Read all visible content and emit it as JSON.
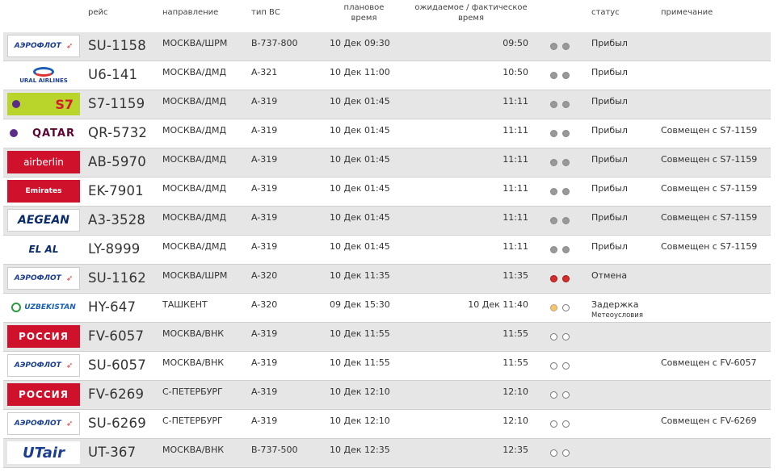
{
  "headers": {
    "flight": "рейс",
    "destination": "направление",
    "aircraft": "тип ВС",
    "scheduled": "плановое время",
    "actual": "ожидаемое / фактическое время",
    "status": "статус",
    "remark": "примечание"
  },
  "rows": [
    {
      "airline": "aeroflot",
      "logo_text": "АЭРОФЛОТ",
      "flight": "SU-1158",
      "dest": "МОСКВА/ШРМ",
      "aircraft": "B-737-800",
      "scheduled": "10 Дек 09:30",
      "actual": "09:50",
      "dots": [
        "grey",
        "grey"
      ],
      "status": "Прибыл",
      "note": "",
      "remark": ""
    },
    {
      "airline": "ural",
      "logo_text": "URAL AIRLINES",
      "flight": "U6-141",
      "dest": "МОСКВА/ДМД",
      "aircraft": "A-321",
      "scheduled": "10 Дек 11:00",
      "actual": "10:50",
      "dots": [
        "grey",
        "grey"
      ],
      "status": "Прибыл",
      "note": "",
      "remark": ""
    },
    {
      "airline": "s7",
      "logo_text": "S7",
      "flight": "S7-1159",
      "dest": "МОСКВА/ДМД",
      "aircraft": "A-319",
      "scheduled": "10 Дек 01:45",
      "actual": "11:11",
      "dots": [
        "grey",
        "grey"
      ],
      "status": "Прибыл",
      "note": "",
      "remark": ""
    },
    {
      "airline": "qatar",
      "logo_text": "QATAR",
      "flight": "QR-5732",
      "dest": "МОСКВА/ДМД",
      "aircraft": "A-319",
      "scheduled": "10 Дек 01:45",
      "actual": "11:11",
      "dots": [
        "grey",
        "grey"
      ],
      "status": "Прибыл",
      "note": "",
      "remark": "Совмещен с S7-1159"
    },
    {
      "airline": "airberlin",
      "logo_text": "airberlin",
      "flight": "AB-5970",
      "dest": "МОСКВА/ДМД",
      "aircraft": "A-319",
      "scheduled": "10 Дек 01:45",
      "actual": "11:11",
      "dots": [
        "grey",
        "grey"
      ],
      "status": "Прибыл",
      "note": "",
      "remark": "Совмещен с S7-1159"
    },
    {
      "airline": "emirates",
      "logo_text": "Emirates",
      "flight": "EK-7901",
      "dest": "МОСКВА/ДМД",
      "aircraft": "A-319",
      "scheduled": "10 Дек 01:45",
      "actual": "11:11",
      "dots": [
        "grey",
        "grey"
      ],
      "status": "Прибыл",
      "note": "",
      "remark": "Совмещен с S7-1159"
    },
    {
      "airline": "aegean",
      "logo_text": "AEGEAN",
      "flight": "A3-3528",
      "dest": "МОСКВА/ДМД",
      "aircraft": "A-319",
      "scheduled": "10 Дек 01:45",
      "actual": "11:11",
      "dots": [
        "grey",
        "grey"
      ],
      "status": "Прибыл",
      "note": "",
      "remark": "Совмещен с S7-1159"
    },
    {
      "airline": "elal",
      "logo_text": "EL AL",
      "flight": "LY-8999",
      "dest": "МОСКВА/ДМД",
      "aircraft": "A-319",
      "scheduled": "10 Дек 01:45",
      "actual": "11:11",
      "dots": [
        "grey",
        "grey"
      ],
      "status": "Прибыл",
      "note": "",
      "remark": "Совмещен с S7-1159"
    },
    {
      "airline": "aeroflot",
      "logo_text": "АЭРОФЛОТ",
      "flight": "SU-1162",
      "dest": "МОСКВА/ШРМ",
      "aircraft": "A-320",
      "scheduled": "10 Дек 11:35",
      "actual": "11:35",
      "dots": [
        "red",
        "red"
      ],
      "status": "Отмена",
      "note": "",
      "remark": ""
    },
    {
      "airline": "uzb",
      "logo_text": "UZBEKISTAN",
      "flight": "HY-647",
      "dest": "ТАШКЕНТ",
      "aircraft": "A-320",
      "scheduled": "09 Дек 15:30",
      "actual": "10 Дек 11:40",
      "dots": [
        "orange",
        "empty"
      ],
      "status": "Задержка",
      "note": "Метеоусловия",
      "remark": ""
    },
    {
      "airline": "rossiya",
      "logo_text": "РОССИЯ",
      "flight": "FV-6057",
      "dest": "МОСКВА/ВНК",
      "aircraft": "A-319",
      "scheduled": "10 Дек 11:55",
      "actual": "11:55",
      "dots": [
        "empty",
        "empty"
      ],
      "status": "",
      "note": "",
      "remark": ""
    },
    {
      "airline": "aeroflot",
      "logo_text": "АЭРОФЛОТ",
      "flight": "SU-6057",
      "dest": "МОСКВА/ВНК",
      "aircraft": "A-319",
      "scheduled": "10 Дек 11:55",
      "actual": "11:55",
      "dots": [
        "empty",
        "empty"
      ],
      "status": "",
      "note": "",
      "remark": "Совмещен с FV-6057"
    },
    {
      "airline": "rossiya",
      "logo_text": "РОССИЯ",
      "flight": "FV-6269",
      "dest": "С-ПЕТЕРБУРГ",
      "aircraft": "A-319",
      "scheduled": "10 Дек 12:10",
      "actual": "12:10",
      "dots": [
        "empty",
        "empty"
      ],
      "status": "",
      "note": "",
      "remark": ""
    },
    {
      "airline": "aeroflot",
      "logo_text": "АЭРОФЛОТ",
      "flight": "SU-6269",
      "dest": "С-ПЕТЕРБУРГ",
      "aircraft": "A-319",
      "scheduled": "10 Дек 12:10",
      "actual": "12:10",
      "dots": [
        "empty",
        "empty"
      ],
      "status": "",
      "note": "",
      "remark": "Совмещен с FV-6269"
    },
    {
      "airline": "utair",
      "logo_text": "UTair",
      "flight": "UT-367",
      "dest": "МОСКВА/ВНК",
      "aircraft": "B-737-500",
      "scheduled": "10 Дек 12:35",
      "actual": "12:35",
      "dots": [
        "empty",
        "empty"
      ],
      "status": "",
      "note": "",
      "remark": ""
    }
  ],
  "colors": {
    "row_shade": "#e6e6e6",
    "cancel": "#d32d2d",
    "delay": "#f3c76a",
    "arrived": "#999999"
  }
}
